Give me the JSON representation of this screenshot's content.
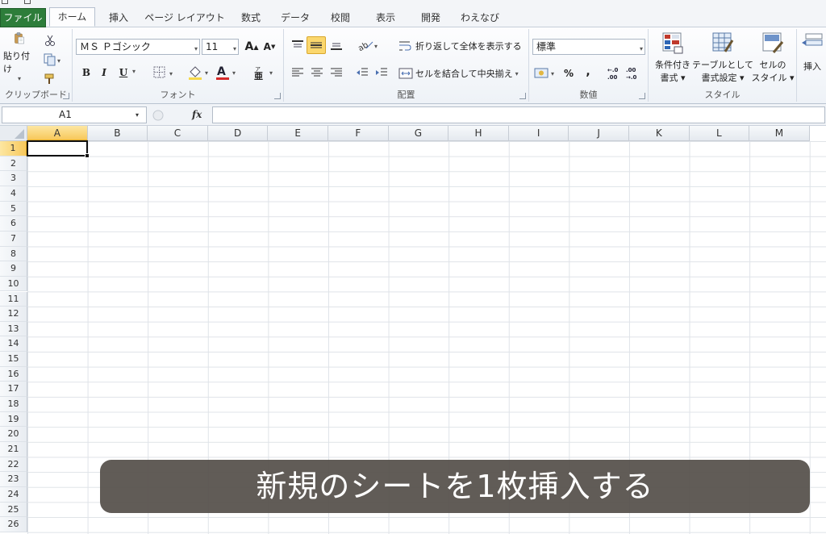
{
  "tabs": [
    "ファイル",
    "ホーム",
    "挿入",
    "ページ レイアウト",
    "数式",
    "データ",
    "校閲",
    "表示",
    "開発",
    "わえなび"
  ],
  "active_tab": "ホーム",
  "ribbon": {
    "clipboard": {
      "label": "クリップボード",
      "paste_label": "貼り付け"
    },
    "font": {
      "label": "フォント",
      "font_name": "ＭＳ Ｐゴシック",
      "font_size": "11",
      "bold": "B",
      "italic": "I",
      "underline": "U"
    },
    "alignment": {
      "label": "配置",
      "wrap_text": "折り返して全体を表示する",
      "merge_center": "セルを結合して中央揃え"
    },
    "number": {
      "label": "数値",
      "format": "標準",
      "percent": "%",
      "comma": ",",
      "inc_decimal": "+.0\n.00",
      "dec_decimal": ".00\n→.0"
    },
    "styles": {
      "label": "スタイル",
      "conditional_line1": "条件付き",
      "conditional_line2": "書式 ▾",
      "table_line1": "テーブルとして",
      "table_line2": "書式設定 ▾",
      "cell_line1": "セルの",
      "cell_line2": "スタイル ▾"
    },
    "cells": {
      "insert_label": "挿入"
    }
  },
  "formula_bar": {
    "name_box": "A1",
    "fx": "fx",
    "formula": ""
  },
  "sheet": {
    "columns": [
      "A",
      "B",
      "C",
      "D",
      "E",
      "F",
      "G",
      "H",
      "I",
      "J",
      "K",
      "L",
      "M"
    ],
    "rows": [
      "1",
      "2",
      "3",
      "4",
      "5",
      "6",
      "7",
      "8",
      "9",
      "10",
      "11",
      "12",
      "13",
      "14",
      "15",
      "16",
      "17",
      "18",
      "19",
      "20",
      "21",
      "22",
      "23",
      "24",
      "25",
      "26"
    ],
    "selected_cell": "A1"
  },
  "caption": "新規のシートを1枚挿入する",
  "colors": {
    "file_tab": "#2d7d3a",
    "selection_header": "#f7c85c",
    "caption_bg": "#55504a"
  }
}
